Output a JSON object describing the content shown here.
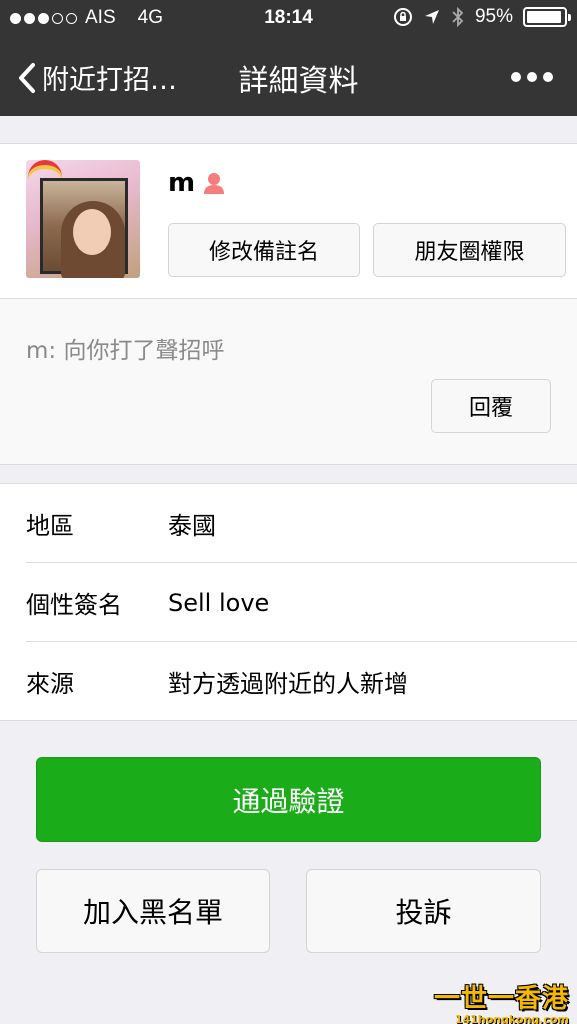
{
  "status_bar": {
    "carrier": "AIS",
    "network": "4G",
    "time": "18:14",
    "battery": "95%",
    "battery_fraction": 0.95,
    "signal_bars_filled": 3,
    "signal_bars_total": 5
  },
  "nav": {
    "back_label": "附近打招…",
    "title": "詳細資料"
  },
  "profile": {
    "name": "m",
    "remark_button": "修改備註名",
    "moments_button": "朋友圈權限"
  },
  "greeting": {
    "message": "m: 向你打了聲招呼",
    "reply_button": "回覆"
  },
  "info": [
    {
      "label": "地區",
      "value": "泰國"
    },
    {
      "label": "個性簽名",
      "value": "Sell love"
    },
    {
      "label": "來源",
      "value": "對方透過附近的人新增"
    }
  ],
  "actions": {
    "verify": "通過驗證",
    "block": "加入黑名單",
    "report": "投訴"
  },
  "watermark": {
    "line1": "一世一香港",
    "line2": "141hongkong.com"
  },
  "colors": {
    "nav_bg": "#353535",
    "page_bg": "#efeff4",
    "primary_green": "#1aad19",
    "female_icon": "#f37e7d"
  }
}
